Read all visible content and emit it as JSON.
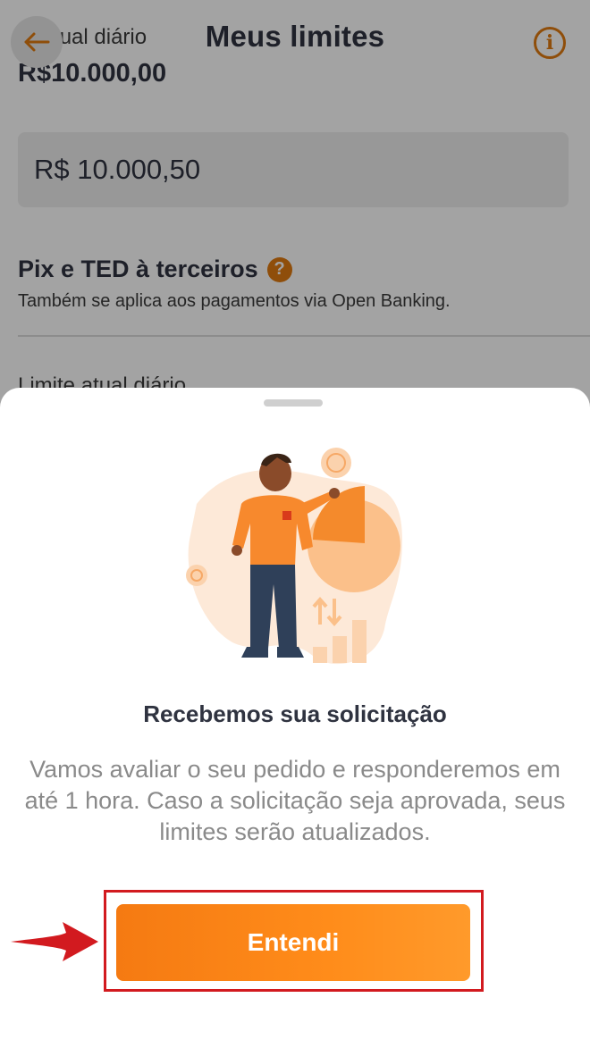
{
  "header": {
    "title": "Meus limites",
    "back_icon": "arrow-left-icon",
    "info_icon": "info-icon",
    "info_glyph": "i"
  },
  "limit": {
    "current_label": "te atual diário",
    "current_value": "R$10.000,00",
    "amount_input": "R$ 10.000,50"
  },
  "section": {
    "title": "Pix e TED à terceiros",
    "help_glyph": "?",
    "subtitle": "Também se aplica aos pagamentos via Open Banking.",
    "next_label": "Limite atual diário"
  },
  "sheet": {
    "title": "Recebemos sua solicitação",
    "text": "Vamos avaliar o seu pedido e responderemos em até 1 hora. Caso a solicitação seja aprovada, seus limites serão atualizados.",
    "button_label": "Entendi"
  },
  "colors": {
    "accent": "#e07a10",
    "button": "#ff8a1a",
    "title": "#2f3340",
    "highlight": "#d21a1f"
  }
}
